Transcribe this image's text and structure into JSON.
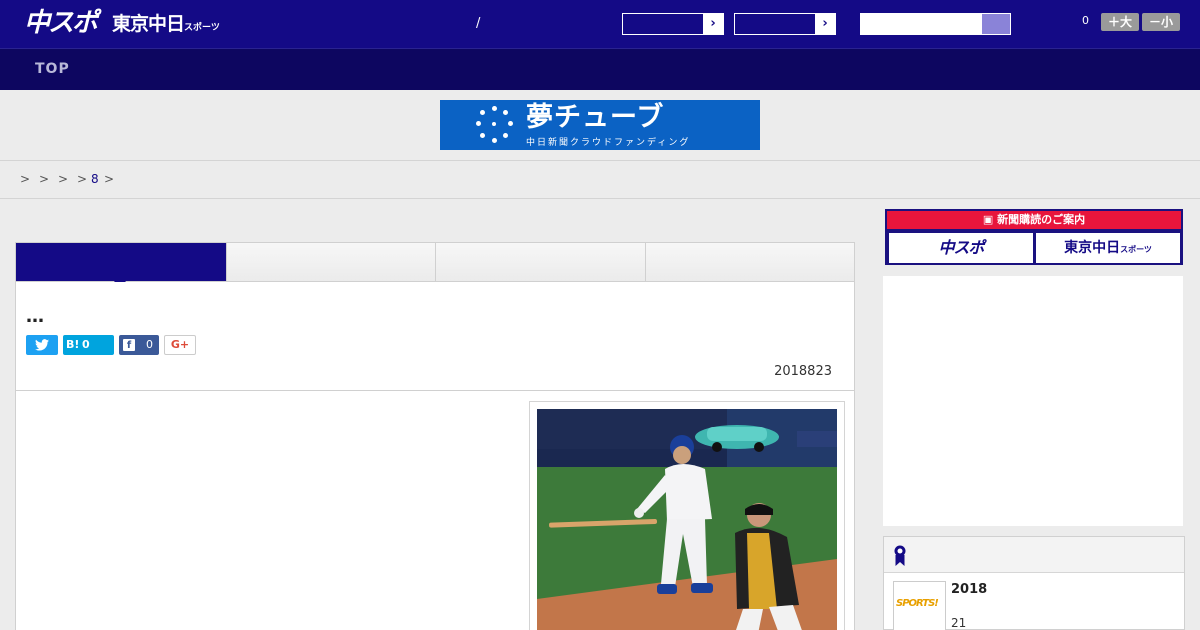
{
  "header": {
    "logo_primary": "中スポ",
    "logo_secondary": "東京中日",
    "logo_secondary_small": "スポーツ",
    "slash": "/",
    "font_count": "0",
    "font_larger": "＋大",
    "font_smaller": "－小",
    "select_arrow": "›"
  },
  "nav": {
    "top_label": "TOP"
  },
  "banner": {
    "title": "夢チューブ",
    "subtitle": "中日新聞クラウドファンディング"
  },
  "breadcrumb": {
    "separator": ">",
    "last_link": "8"
  },
  "article": {
    "title": "…",
    "share": {
      "twitter_icon": "twitter-bird",
      "hatena_label": "B!",
      "hatena_count": "0",
      "facebook_icon_letter": "f",
      "facebook_count": "0",
      "gplus_label": "G+"
    },
    "date": "2018823"
  },
  "sidebar": {
    "subscribe_heading": "新聞購読のご案内",
    "subscribe_chuspo": "中スポ",
    "subscribe_tokyo": "東京中日",
    "subscribe_tokyo_small": "スポーツ",
    "ranking": {
      "year": "2018",
      "sub": "21",
      "thumb_text": "SPORTS!"
    }
  },
  "colors": {
    "header_bg": "#140a86",
    "nav_bg": "#0d0660",
    "accent_red": "#e8153c",
    "banner_blue": "#0b62c4"
  }
}
